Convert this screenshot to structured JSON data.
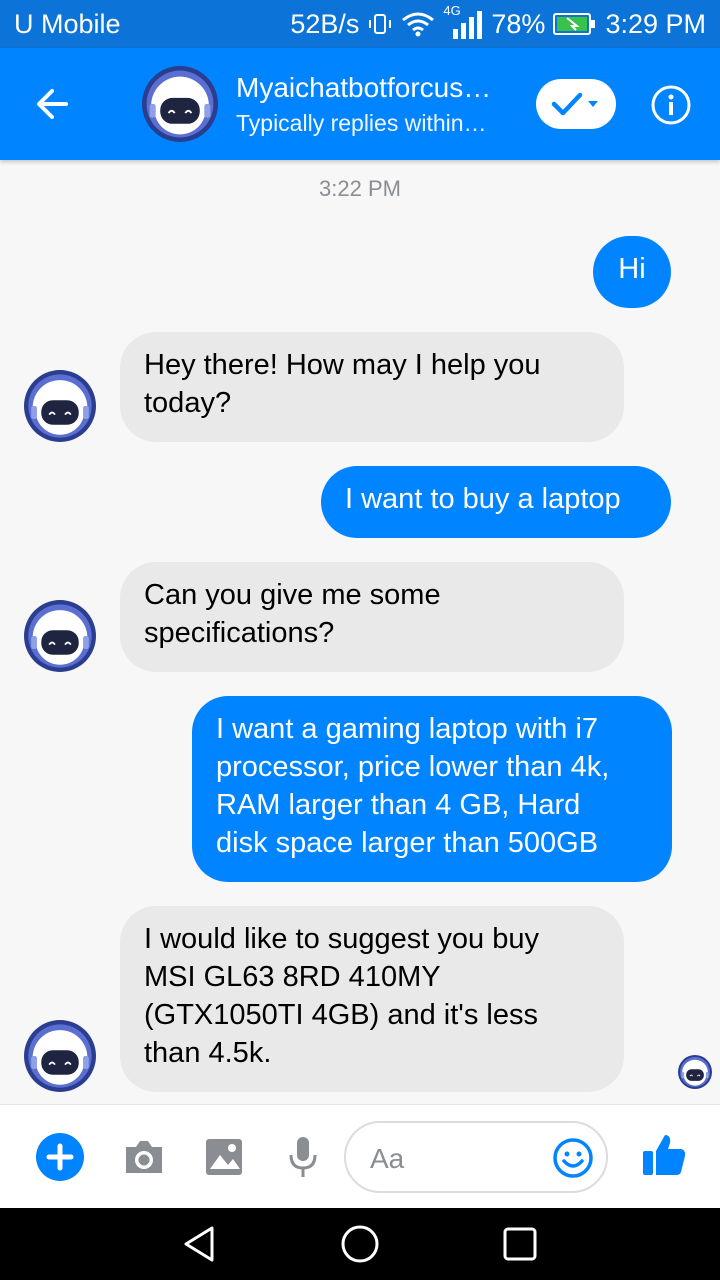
{
  "status_bar": {
    "carrier": "U Mobile",
    "speed": "52B/s",
    "network": "4G",
    "battery": "78%",
    "time": "3:29 PM"
  },
  "header": {
    "title": "Myaichatbotforcus…",
    "subtitle": "Typically replies within…"
  },
  "chat": {
    "timestamp": "3:22 PM",
    "messages": [
      {
        "from": "user",
        "text": "Hi"
      },
      {
        "from": "bot",
        "lines": [
          "Hey there! How may I help you",
          "today?"
        ]
      },
      {
        "from": "user",
        "text": "I want to buy a laptop"
      },
      {
        "from": "bot",
        "lines": [
          "Can you give me some",
          "specifications?"
        ]
      },
      {
        "from": "user",
        "lines": [
          "I want a gaming laptop with i7",
          "processor, price lower than 4k,",
          "RAM larger than 4 GB, Hard",
          "disk space larger than 500GB"
        ]
      },
      {
        "from": "bot",
        "lines": [
          "I would like to suggest you buy",
          "MSI GL63 8RD 410MY",
          "(GTX1050TI 4GB) and it's less",
          "than 4.5k."
        ]
      }
    ]
  },
  "composer": {
    "placeholder": "Aa"
  },
  "colors": {
    "brand": "#0084ff",
    "status_bar": "#0c73d8",
    "incoming_bubble": "#e9e9e9"
  },
  "icons": [
    "back-arrow-icon",
    "check-icon",
    "info-icon",
    "plus-icon",
    "camera-icon",
    "image-icon",
    "microphone-icon",
    "emoji-icon",
    "thumbs-up-icon",
    "nav-back-icon",
    "nav-home-icon",
    "nav-recents-icon"
  ]
}
